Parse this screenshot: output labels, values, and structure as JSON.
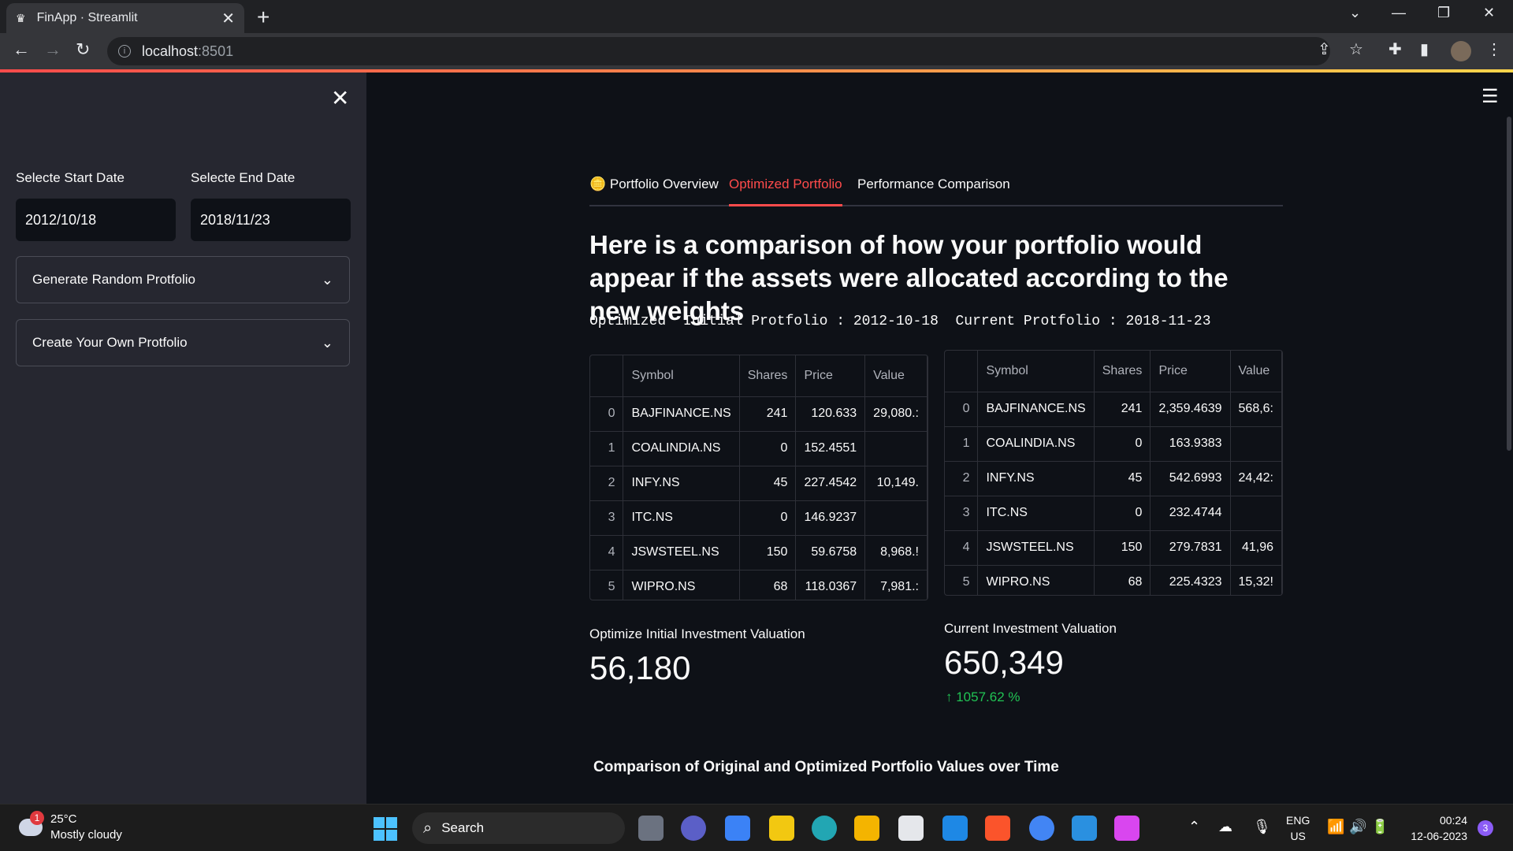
{
  "browser": {
    "tab_title": "FinApp · Streamlit",
    "url_host": "localhost",
    "url_port": ":8501"
  },
  "sidebar": {
    "start_label": "Selecte Start Date",
    "end_label": "Selecte End Date",
    "start_value": "2012/10/18",
    "end_value": "2018/11/23",
    "expanders": [
      "Generate Random Protfolio",
      "Create Your Own Protfolio"
    ]
  },
  "tabs": [
    "Portfolio Overview",
    "Optimized Portfolio",
    "Performance Comparison"
  ],
  "heading": "Here is a comparison of how your portfolio would appear if the assets were allocated according to the new weights",
  "subline": "Optimized  Initial Protfolio : 2012-10-18  Current Protfolio : 2018-11-23",
  "tables": {
    "columns": [
      "",
      "Symbol",
      "Shares",
      "Price",
      "Value"
    ],
    "initial": [
      [
        "0",
        "BAJFINANCE.NS",
        "241",
        "120.633",
        "29,080.:"
      ],
      [
        "1",
        "COALINDIA.NS",
        "0",
        "152.4551",
        ""
      ],
      [
        "2",
        "INFY.NS",
        "45",
        "227.4542",
        "10,149."
      ],
      [
        "3",
        "ITC.NS",
        "0",
        "146.9237",
        ""
      ],
      [
        "4",
        "JSWSTEEL.NS",
        "150",
        "59.6758",
        "8,968.!"
      ],
      [
        "5",
        "WIPRO.NS",
        "68",
        "118.0367",
        "7,981.:"
      ]
    ],
    "current": [
      [
        "0",
        "BAJFINANCE.NS",
        "241",
        "2,359.4639",
        "568,6:"
      ],
      [
        "1",
        "COALINDIA.NS",
        "0",
        "163.9383",
        ""
      ],
      [
        "2",
        "INFY.NS",
        "45",
        "542.6993",
        "24,42:"
      ],
      [
        "3",
        "ITC.NS",
        "0",
        "232.4744",
        ""
      ],
      [
        "4",
        "JSWSTEEL.NS",
        "150",
        "279.7831",
        "41,96"
      ],
      [
        "5",
        "WIPRO.NS",
        "68",
        "225.4323",
        "15,32!"
      ]
    ]
  },
  "metrics": {
    "initial_label": "Optimize Initial Investment Valuation",
    "initial_value": "56,180",
    "current_label": "Current Investment Valuation",
    "current_value": "650,349",
    "delta": "↑ 1057.62 %"
  },
  "chart_title": "Comparison of Original and Optimized Portfolio Values over Time",
  "taskbar": {
    "weather_badge": "1",
    "temp": "25°C",
    "weather": "Mostly cloudy",
    "search": "Search",
    "lang1": "ENG",
    "lang2": "US",
    "time": "00:24",
    "date": "12-06-2023",
    "notif_count": "3"
  }
}
